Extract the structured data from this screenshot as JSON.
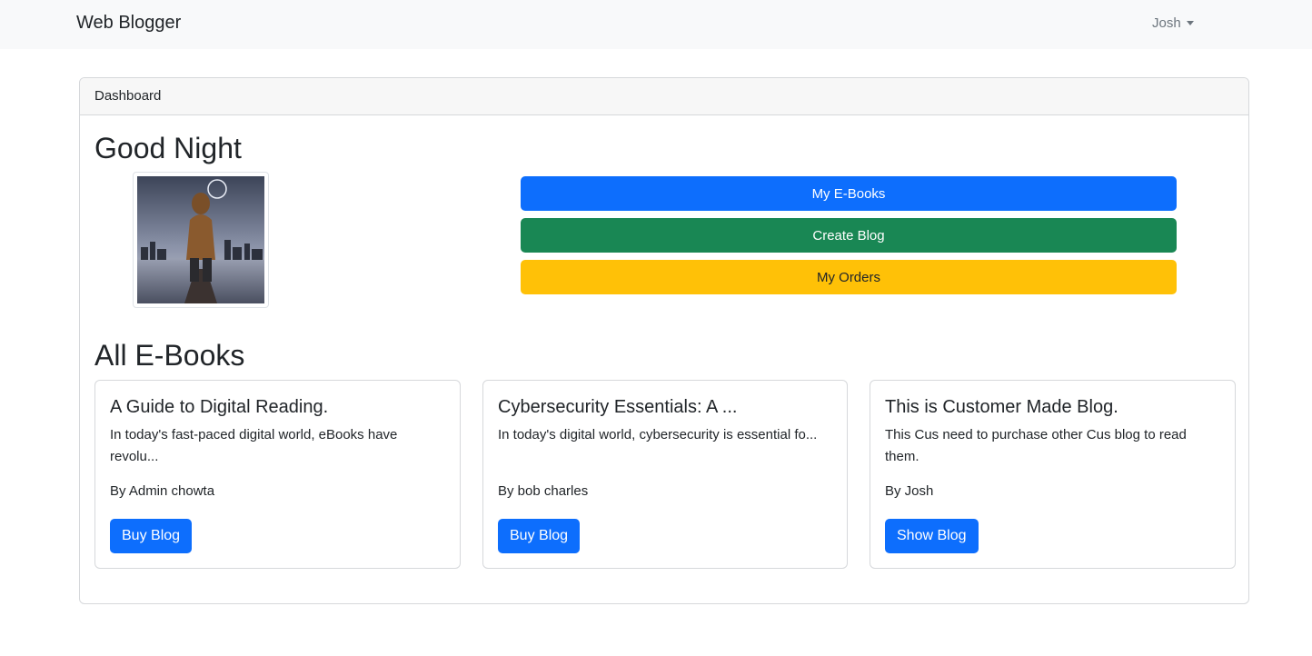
{
  "navbar": {
    "brand": "Web Blogger",
    "user": "Josh"
  },
  "dashboard": {
    "header": "Dashboard",
    "greeting": "Good Night",
    "actions": {
      "ebooks": "My E-Books",
      "create_blog": "Create Blog",
      "orders": "My Orders"
    }
  },
  "ebooks": {
    "title": "All E-Books",
    "items": [
      {
        "title": "A Guide to Digital Reading.",
        "excerpt": "In today's fast-paced digital world, eBooks have revolu...",
        "author": "By Admin chowta",
        "button": "Buy Blog"
      },
      {
        "title": "Cybersecurity Essentials: A ...",
        "excerpt": "In today's digital world, cybersecurity is essential fo...",
        "author": "By bob charles",
        "button": "Buy Blog"
      },
      {
        "title": "This is Customer Made Blog.",
        "excerpt": "This Cus need to purchase other Cus blog to read them.",
        "author": "By Josh",
        "button": "Show Blog"
      }
    ]
  },
  "colors": {
    "primary": "#0d6efd",
    "success": "#198754",
    "warning": "#ffc107",
    "navbar_bg": "#f8f9fa"
  }
}
